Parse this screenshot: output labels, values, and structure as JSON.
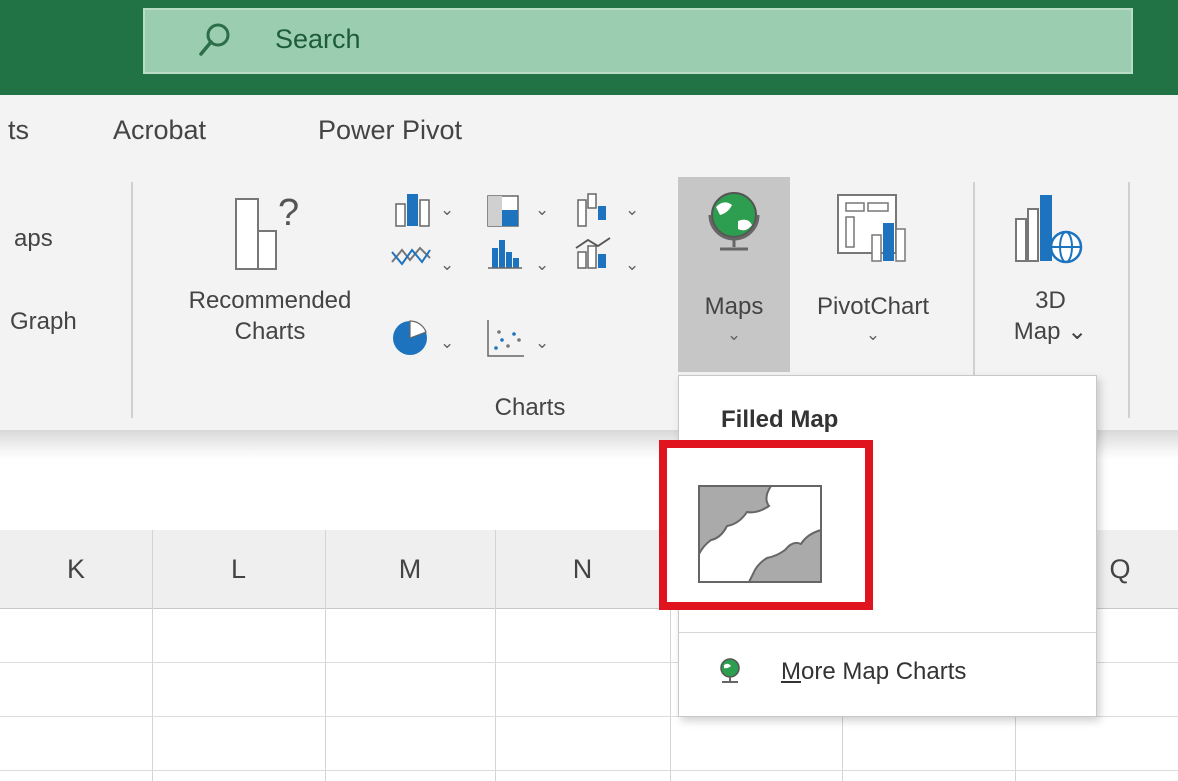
{
  "search": {
    "label": "Search"
  },
  "tabs": [
    {
      "label": "ts"
    },
    {
      "label": "Acrobat"
    },
    {
      "label": "Power Pivot"
    }
  ],
  "ribbon": {
    "left_partial": {
      "line1": "aps",
      "line2": "Graph"
    },
    "recommended_charts": {
      "line1": "Recommended",
      "line2": "Charts"
    },
    "maps": {
      "label": "Maps",
      "chevron": "⌄"
    },
    "pivotchart": {
      "label": "PivotChart",
      "chevron": "⌄"
    },
    "map3d": {
      "line1": "3D",
      "line2": "Map ⌄"
    },
    "charts_group_label": "Charts",
    "dropdown_arrow": "⌄"
  },
  "columns": [
    "K",
    "L",
    "M",
    "N",
    "Q"
  ],
  "dropdown": {
    "heading": "Filled Map",
    "more_label_mnemonic": "M",
    "more_label_rest": "ore Map Charts"
  },
  "colors": {
    "title_bar": "#217346",
    "search_bg": "#9bcdb0",
    "ribbon_bg": "#f3f3f3",
    "maps_button_active": "#c6c6c6",
    "highlight_box": "#e0141e"
  },
  "icons": [
    "search-icon",
    "recommended-charts-icon",
    "column-chart-icon",
    "hierarchy-chart-icon",
    "waterfall-chart-icon",
    "line-chart-icon",
    "statistic-chart-icon",
    "combo-chart-icon",
    "pie-chart-icon",
    "scatter-chart-icon",
    "globe-icon",
    "pivotchart-icon",
    "3d-map-icon",
    "filled-map-icon",
    "more-maps-globe-icon"
  ]
}
